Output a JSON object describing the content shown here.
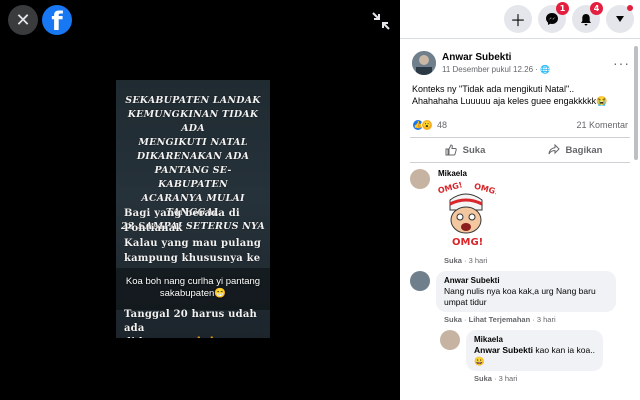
{
  "viewer": {
    "photo_lines_top": [
      "SEKABUPATEN LANDAK",
      "KEMUNGKINAN TIDAK ADA",
      "MENGIKUTI NATAL",
      "DIKARENAKAN ADA",
      "PANTANG SE-KABUPATEN",
      "ACARANYA MULAI TANGGAL",
      "23 SAMPAI SETERUS NYA"
    ],
    "photo_lines_mid": [
      "Bagi yang berada di",
      "Pontianak",
      "Kalau yang mau pulang",
      "kampung khususnya ke"
    ],
    "photo_overlay": "Koa boh nang curlha yi pantang sakabupaten😁",
    "photo_lines_bottom": [
      "Tanggal 20 harus udah ada",
      "di kampung🙏🙏"
    ]
  },
  "topbar": {
    "messenger_badge": "1",
    "notifications_badge": "4"
  },
  "post": {
    "author": "Anwar Subekti",
    "time": "11 Desember pukul 12.26 · ",
    "text_line1": "Konteks ny \"Tidak ada mengikuti Natal\"..",
    "text_line2": "Ahahahaha Luuuuu aja keles guee engakkkkk😭",
    "reaction_count": "48",
    "comment_count": "21 Komentar",
    "like_label": "Suka",
    "share_label": "Bagikan"
  },
  "comments": [
    {
      "name": "Mikaela",
      "sticker_text": "OMG!",
      "like": "Suka",
      "time": "3 hari"
    },
    {
      "name": "Anwar Subekti",
      "text": "Nang nulis nya koa kak,a urg Nang baru umpat tidur",
      "like": "Suka",
      "translate": "Lihat Terjemahan",
      "time": "3 hari"
    },
    {
      "name": "Mikaela",
      "mention": "Anwar Subekti",
      "text": " kao kan ia koa..",
      "emoji": "😀",
      "like": "Suka",
      "time": "3 hari"
    }
  ],
  "colors": {
    "brand": "#1877f2",
    "badge": "#e41e3f"
  }
}
